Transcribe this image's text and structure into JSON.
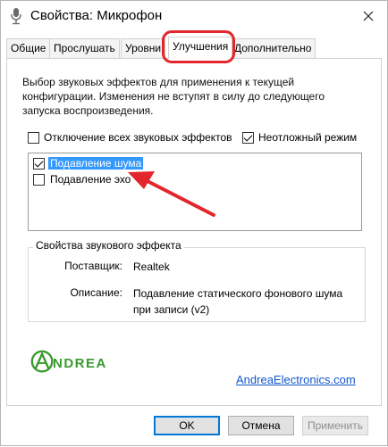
{
  "window": {
    "title": "Свойства: Микрофон",
    "icon": "microphone-icon",
    "close_glyph": "✕"
  },
  "tabs": [
    {
      "label": "Общие"
    },
    {
      "label": "Прослушать"
    },
    {
      "label": "Уровни"
    },
    {
      "label": "Улучшения",
      "active": true
    },
    {
      "label": "Дополнительно"
    }
  ],
  "description": "Выбор звуковых эффектов для применения к текущей конфигурации. Изменения не вступят в силу до следующего запуска воспроизведения.",
  "options": {
    "disable_all": {
      "label": "Отключение всех звуковых эффектов",
      "checked": false
    },
    "immediate_mode": {
      "label": "Неотложный режим",
      "checked": true
    }
  },
  "effects": [
    {
      "label": "Подавление шума",
      "checked": true,
      "selected": true
    },
    {
      "label": "Подавление эхо",
      "checked": false,
      "selected": false
    }
  ],
  "properties": {
    "group_title": "Свойства звукового эффекта",
    "provider_label": "Поставщик:",
    "provider_value": "Realtek",
    "description_label": "Описание:",
    "description_value_line1": "Подавление статического фонового шума",
    "description_value_line2": "при записи (v2)"
  },
  "logo": {
    "text": "NDREA"
  },
  "link": "AndreaElectronics.com",
  "buttons": {
    "ok": "OK",
    "cancel": "Отмена",
    "apply": "Применить"
  },
  "colors": {
    "highlight_red": "#e3262b",
    "selection_blue": "#3399ff",
    "logo_green": "#3a9a2e",
    "link_blue": "#1155cc"
  }
}
